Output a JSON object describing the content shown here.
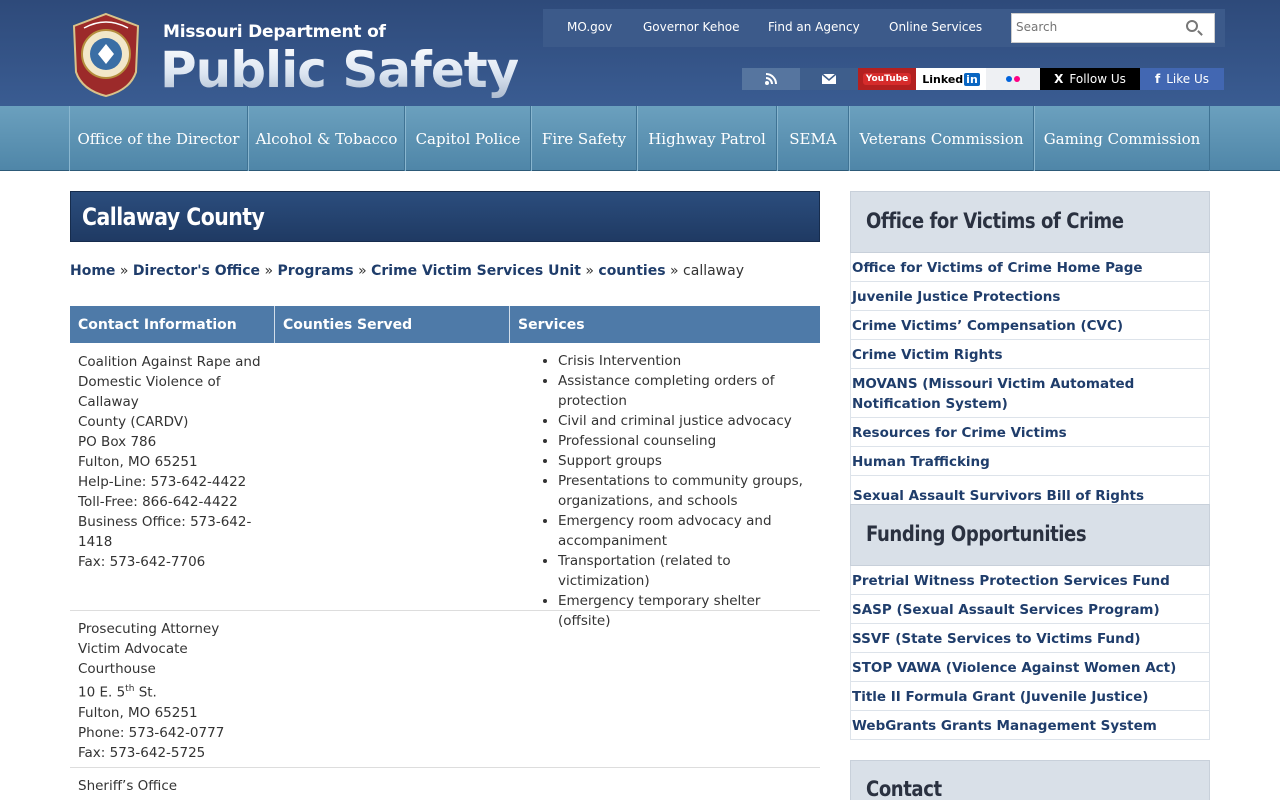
{
  "header": {
    "site_top": "Missouri Department of",
    "site_main": "Public Safety",
    "toplinks": [
      "MO.gov",
      "Governor Kehoe",
      "Find an Agency",
      "Online Services"
    ],
    "search_placeholder": "Search",
    "social": {
      "youtube": "YouTube",
      "linkedin": "Linked",
      "linkedin_in": "in",
      "follow": "Follow Us",
      "like": "Like Us",
      "x_glyph": "X",
      "fb_glyph": "f"
    }
  },
  "nav": {
    "items": [
      "Office of the Director",
      "Alcohol & Tobacco",
      "Capitol Police",
      "Fire Safety",
      "Highway Patrol",
      "SEMA",
      "Veterans Commission",
      "Gaming Commission"
    ]
  },
  "main": {
    "title": "Callaway County",
    "breadcrumbs": [
      "Home",
      "Director's Office",
      "Programs",
      "Crime Victim Services Unit",
      "counties"
    ],
    "breadcrumb_current": "callaway",
    "breadcrumb_sep": "»",
    "table": {
      "headers": [
        "Contact Information",
        "Counties Served",
        "Services"
      ],
      "row1_contact": [
        "Coalition Against Rape and",
        "Domestic Violence of Callaway",
        "County (CARDV)",
        "PO Box 786",
        "Fulton, MO 65251",
        "Help-Line: 573-642-4422",
        "Toll-Free: 866-642-4422",
        "Business Office: 573-642-",
        "1418",
        "Fax: 573-642-7706"
      ],
      "row1_services": [
        "Crisis Intervention",
        "Assistance completing orders of protection",
        "Civil and criminal justice advocacy",
        "Professional counseling",
        "Support groups",
        "Presentations to community groups, organizations, and schools",
        "Emergency room advocacy and accompaniment",
        "Transportation (related to victimization)",
        "Emergency temporary shelter (offsite)"
      ],
      "row2_contact": {
        "l1": "Prosecuting Attorney",
        "l2": "Victim Advocate",
        "l3": "Courthouse",
        "l4_pre": "10 E. 5",
        "l4_sup": "th",
        "l4_post": " St.",
        "l5": "Fulton, MO 65251",
        "l6": "Phone: 573-642-0777",
        "l7": "Fax: 573-642-5725"
      },
      "row3_contact": "Sheriff’s Office"
    }
  },
  "sidebar": {
    "section1_title": "Office for Victims of Crime",
    "section1_links": [
      "Office for Victims of Crime Home Page",
      "Juvenile Justice Protections",
      "Crime Victims’ Compensation (CVC)",
      "Crime Victim Rights",
      "MOVANS (Missouri Victim Automated Notification System)",
      "Resources for Crime Victims",
      "Human Trafficking",
      "Sexual Assault Survivors Bill of Rights"
    ],
    "section2_title": "Funding Opportunities",
    "section2_links": [
      "Pretrial Witness Protection Services Fund",
      "SASP (Sexual Assault Services Program)",
      "SSVF (State Services to Victims Fund)",
      "STOP VAWA (Violence Against Women Act)",
      "Title II Formula Grant (Juvenile Justice)",
      "WebGrants Grants Management System"
    ],
    "contact_title": "Contact"
  }
}
